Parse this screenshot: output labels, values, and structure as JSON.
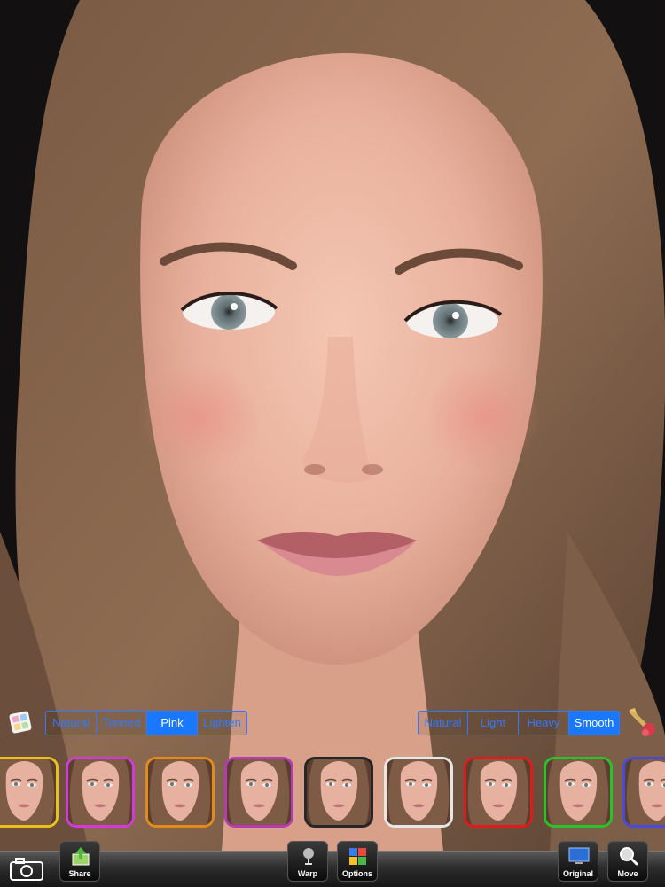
{
  "beauty_tools": {
    "left_group": {
      "icon": "palette-icon",
      "options": [
        "Natural",
        "Tanned",
        "Pink",
        "Lighten"
      ],
      "selected": "Pink"
    },
    "right_group": {
      "icon": "brush-icon",
      "options": [
        "Natural",
        "Light",
        "Heavy",
        "Smooth"
      ],
      "selected": "Smooth"
    }
  },
  "thumbnails": [
    {
      "border": "#e8c21a"
    },
    {
      "border": "#d23bd3"
    },
    {
      "border": "#e38a1a"
    },
    {
      "border": "#b43cb0"
    },
    {
      "border": "#262626"
    },
    {
      "border": "#e6e6e6"
    },
    {
      "border": "#e11b1b"
    },
    {
      "border": "#2ac12a"
    },
    {
      "border": "#4a4ad6"
    }
  ],
  "toolbar": {
    "share_label": "Share",
    "warp_label": "Warp",
    "options_label": "Options",
    "original_label": "Original",
    "move_label": "Move"
  },
  "colors": {
    "accent": "#1a78ff"
  }
}
